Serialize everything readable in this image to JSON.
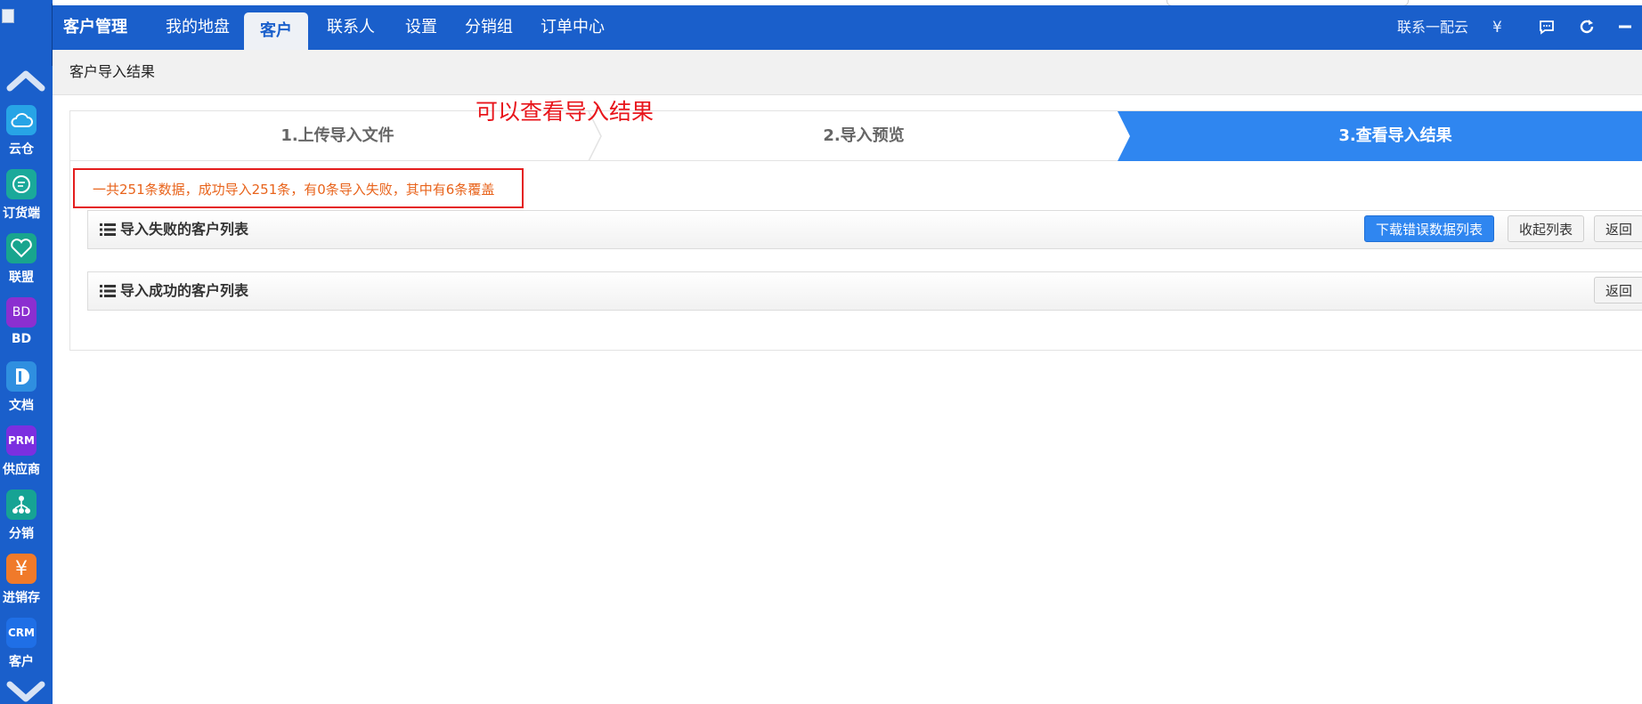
{
  "sidebar": {
    "apps": [
      {
        "label": "云仓",
        "icon": "cloud-icon",
        "color": "#27a4e6"
      },
      {
        "label": "订货端",
        "icon": "chat-bubble-icon",
        "color": "#1aa99a"
      },
      {
        "label": "联盟",
        "icon": "heart-handshake-icon",
        "color": "#18a58e"
      },
      {
        "label": "BD",
        "icon_text": "BD",
        "color": "#8b2fd0"
      },
      {
        "label": "文档",
        "icon": "document-icon",
        "color": "#2f8fe0"
      },
      {
        "label": "供应商",
        "icon_text": "PRM",
        "color": "#7b2fe0"
      },
      {
        "label": "分销",
        "icon": "hierarchy-icon",
        "color": "#16a394"
      },
      {
        "label": "进销存",
        "icon_text": "¥",
        "color": "#f07a2a"
      },
      {
        "label": "客户",
        "icon_text": "CRM",
        "color": "#1f6fe6"
      }
    ]
  },
  "topbar": {
    "brand": "客户管理",
    "tabs": [
      "我的地盘",
      "客户",
      "联系人",
      "设置",
      "分销组",
      "订单中心"
    ],
    "active_tab": "客户",
    "contact_text": "联系一配云",
    "currency_symbol": "¥"
  },
  "page": {
    "title": "客户导入结果",
    "annotation": "可以查看导入结果",
    "steps": [
      "1.上传导入文件",
      "2.导入预览",
      "3.查看导入结果"
    ],
    "active_step": 3,
    "summary": "一共251条数据，成功导入251条，有0条导入失败，其中有6条覆盖",
    "failed_list": {
      "title": "导入失败的客户列表",
      "download_button": "下载错误数据列表",
      "collapse_button": "收起列表",
      "back_button": "返回"
    },
    "success_list": {
      "title": "导入成功的客户列表",
      "back_button": "返回"
    }
  },
  "colors": {
    "brand_blue": "#1a5fcb",
    "step_active": "#2f86f0",
    "annotation_red": "#e8161c",
    "summary_orange": "#e8631b"
  }
}
